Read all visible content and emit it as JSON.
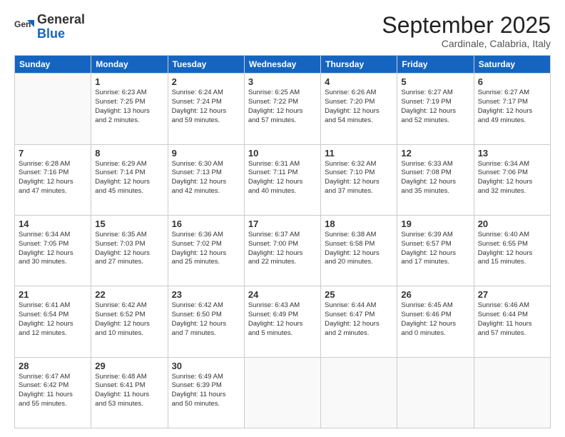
{
  "logo": {
    "general": "General",
    "blue": "Blue"
  },
  "header": {
    "month": "September 2025",
    "location": "Cardinale, Calabria, Italy"
  },
  "weekdays": [
    "Sunday",
    "Monday",
    "Tuesday",
    "Wednesday",
    "Thursday",
    "Friday",
    "Saturday"
  ],
  "weeks": [
    [
      {
        "day": "",
        "info": ""
      },
      {
        "day": "1",
        "info": "Sunrise: 6:23 AM\nSunset: 7:25 PM\nDaylight: 13 hours\nand 2 minutes."
      },
      {
        "day": "2",
        "info": "Sunrise: 6:24 AM\nSunset: 7:24 PM\nDaylight: 12 hours\nand 59 minutes."
      },
      {
        "day": "3",
        "info": "Sunrise: 6:25 AM\nSunset: 7:22 PM\nDaylight: 12 hours\nand 57 minutes."
      },
      {
        "day": "4",
        "info": "Sunrise: 6:26 AM\nSunset: 7:20 PM\nDaylight: 12 hours\nand 54 minutes."
      },
      {
        "day": "5",
        "info": "Sunrise: 6:27 AM\nSunset: 7:19 PM\nDaylight: 12 hours\nand 52 minutes."
      },
      {
        "day": "6",
        "info": "Sunrise: 6:27 AM\nSunset: 7:17 PM\nDaylight: 12 hours\nand 49 minutes."
      }
    ],
    [
      {
        "day": "7",
        "info": "Sunrise: 6:28 AM\nSunset: 7:16 PM\nDaylight: 12 hours\nand 47 minutes."
      },
      {
        "day": "8",
        "info": "Sunrise: 6:29 AM\nSunset: 7:14 PM\nDaylight: 12 hours\nand 45 minutes."
      },
      {
        "day": "9",
        "info": "Sunrise: 6:30 AM\nSunset: 7:13 PM\nDaylight: 12 hours\nand 42 minutes."
      },
      {
        "day": "10",
        "info": "Sunrise: 6:31 AM\nSunset: 7:11 PM\nDaylight: 12 hours\nand 40 minutes."
      },
      {
        "day": "11",
        "info": "Sunrise: 6:32 AM\nSunset: 7:10 PM\nDaylight: 12 hours\nand 37 minutes."
      },
      {
        "day": "12",
        "info": "Sunrise: 6:33 AM\nSunset: 7:08 PM\nDaylight: 12 hours\nand 35 minutes."
      },
      {
        "day": "13",
        "info": "Sunrise: 6:34 AM\nSunset: 7:06 PM\nDaylight: 12 hours\nand 32 minutes."
      }
    ],
    [
      {
        "day": "14",
        "info": "Sunrise: 6:34 AM\nSunset: 7:05 PM\nDaylight: 12 hours\nand 30 minutes."
      },
      {
        "day": "15",
        "info": "Sunrise: 6:35 AM\nSunset: 7:03 PM\nDaylight: 12 hours\nand 27 minutes."
      },
      {
        "day": "16",
        "info": "Sunrise: 6:36 AM\nSunset: 7:02 PM\nDaylight: 12 hours\nand 25 minutes."
      },
      {
        "day": "17",
        "info": "Sunrise: 6:37 AM\nSunset: 7:00 PM\nDaylight: 12 hours\nand 22 minutes."
      },
      {
        "day": "18",
        "info": "Sunrise: 6:38 AM\nSunset: 6:58 PM\nDaylight: 12 hours\nand 20 minutes."
      },
      {
        "day": "19",
        "info": "Sunrise: 6:39 AM\nSunset: 6:57 PM\nDaylight: 12 hours\nand 17 minutes."
      },
      {
        "day": "20",
        "info": "Sunrise: 6:40 AM\nSunset: 6:55 PM\nDaylight: 12 hours\nand 15 minutes."
      }
    ],
    [
      {
        "day": "21",
        "info": "Sunrise: 6:41 AM\nSunset: 6:54 PM\nDaylight: 12 hours\nand 12 minutes."
      },
      {
        "day": "22",
        "info": "Sunrise: 6:42 AM\nSunset: 6:52 PM\nDaylight: 12 hours\nand 10 minutes."
      },
      {
        "day": "23",
        "info": "Sunrise: 6:42 AM\nSunset: 6:50 PM\nDaylight: 12 hours\nand 7 minutes."
      },
      {
        "day": "24",
        "info": "Sunrise: 6:43 AM\nSunset: 6:49 PM\nDaylight: 12 hours\nand 5 minutes."
      },
      {
        "day": "25",
        "info": "Sunrise: 6:44 AM\nSunset: 6:47 PM\nDaylight: 12 hours\nand 2 minutes."
      },
      {
        "day": "26",
        "info": "Sunrise: 6:45 AM\nSunset: 6:46 PM\nDaylight: 12 hours\nand 0 minutes."
      },
      {
        "day": "27",
        "info": "Sunrise: 6:46 AM\nSunset: 6:44 PM\nDaylight: 11 hours\nand 57 minutes."
      }
    ],
    [
      {
        "day": "28",
        "info": "Sunrise: 6:47 AM\nSunset: 6:42 PM\nDaylight: 11 hours\nand 55 minutes."
      },
      {
        "day": "29",
        "info": "Sunrise: 6:48 AM\nSunset: 6:41 PM\nDaylight: 11 hours\nand 53 minutes."
      },
      {
        "day": "30",
        "info": "Sunrise: 6:49 AM\nSunset: 6:39 PM\nDaylight: 11 hours\nand 50 minutes."
      },
      {
        "day": "",
        "info": ""
      },
      {
        "day": "",
        "info": ""
      },
      {
        "day": "",
        "info": ""
      },
      {
        "day": "",
        "info": ""
      }
    ]
  ]
}
